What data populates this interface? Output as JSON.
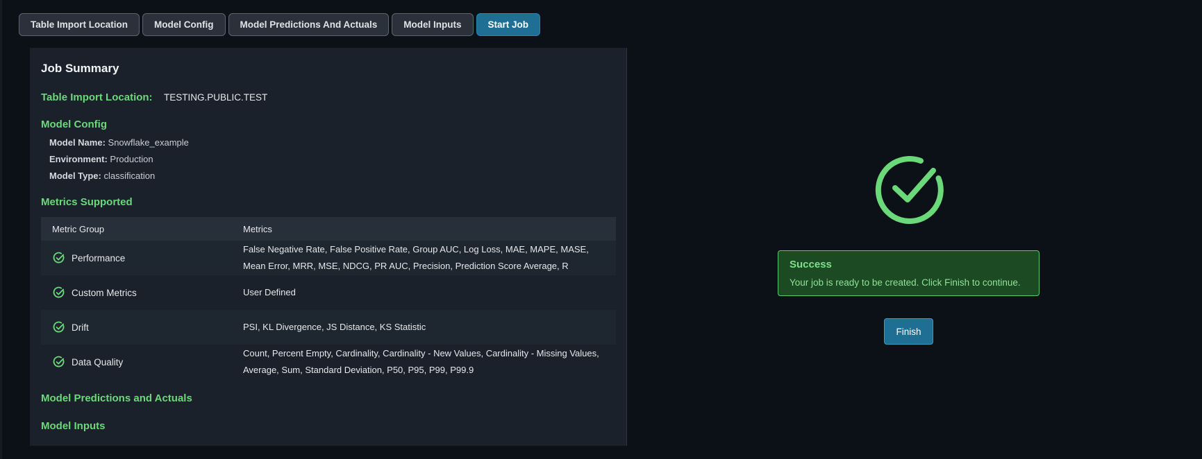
{
  "tabs": [
    {
      "label": "Table Import Location",
      "active": false
    },
    {
      "label": "Model Config",
      "active": false
    },
    {
      "label": "Model Predictions And Actuals",
      "active": false
    },
    {
      "label": "Model Inputs",
      "active": false
    },
    {
      "label": "Start Job",
      "active": true
    }
  ],
  "summary": {
    "title": "Job Summary",
    "table_import": {
      "label": "Table Import Location:",
      "value": "TESTING.PUBLIC.TEST"
    },
    "model_config": {
      "heading": "Model Config",
      "fields": [
        {
          "key": "Model Name:",
          "value": "Snowflake_example"
        },
        {
          "key": "Environment:",
          "value": "Production"
        },
        {
          "key": "Model Type:",
          "value": "classification"
        }
      ]
    },
    "metrics": {
      "heading": "Metrics Supported",
      "columns": [
        "Metric Group",
        "Metrics"
      ],
      "rows": [
        {
          "group": "Performance",
          "metrics": "False Negative Rate, False Positive Rate, Group AUC, Log Loss, MAE, MAPE, MASE, Mean Error, MRR, MSE, NDCG, PR AUC, Precision, Prediction Score Average, R",
          "icon": "check-circle-icon"
        },
        {
          "group": "Custom Metrics",
          "metrics": "User Defined",
          "icon": "check-circle-icon"
        },
        {
          "group": "Drift",
          "metrics": "PSI, KL Divergence, JS Distance, KS Statistic",
          "icon": "check-circle-icon"
        },
        {
          "group": "Data Quality",
          "metrics": "Count, Percent Empty, Cardinality, Cardinality - New Values, Cardinality - Missing Values, Average, Sum, Standard Deviation, P50, P95, P99, P99.9",
          "icon": "check-circle-icon"
        }
      ]
    },
    "predictions_heading": "Model Predictions and Actuals",
    "inputs_heading": "Model Inputs"
  },
  "success": {
    "icon": "success-check-icon",
    "title": "Success",
    "message": "Your job is ready to be created. Click Finish to continue."
  },
  "finish_label": "Finish",
  "colors": {
    "accent_green": "#6bd97a",
    "primary_blue": "#1f6f94",
    "background": "#0c1118",
    "panel": "#1a212b"
  }
}
